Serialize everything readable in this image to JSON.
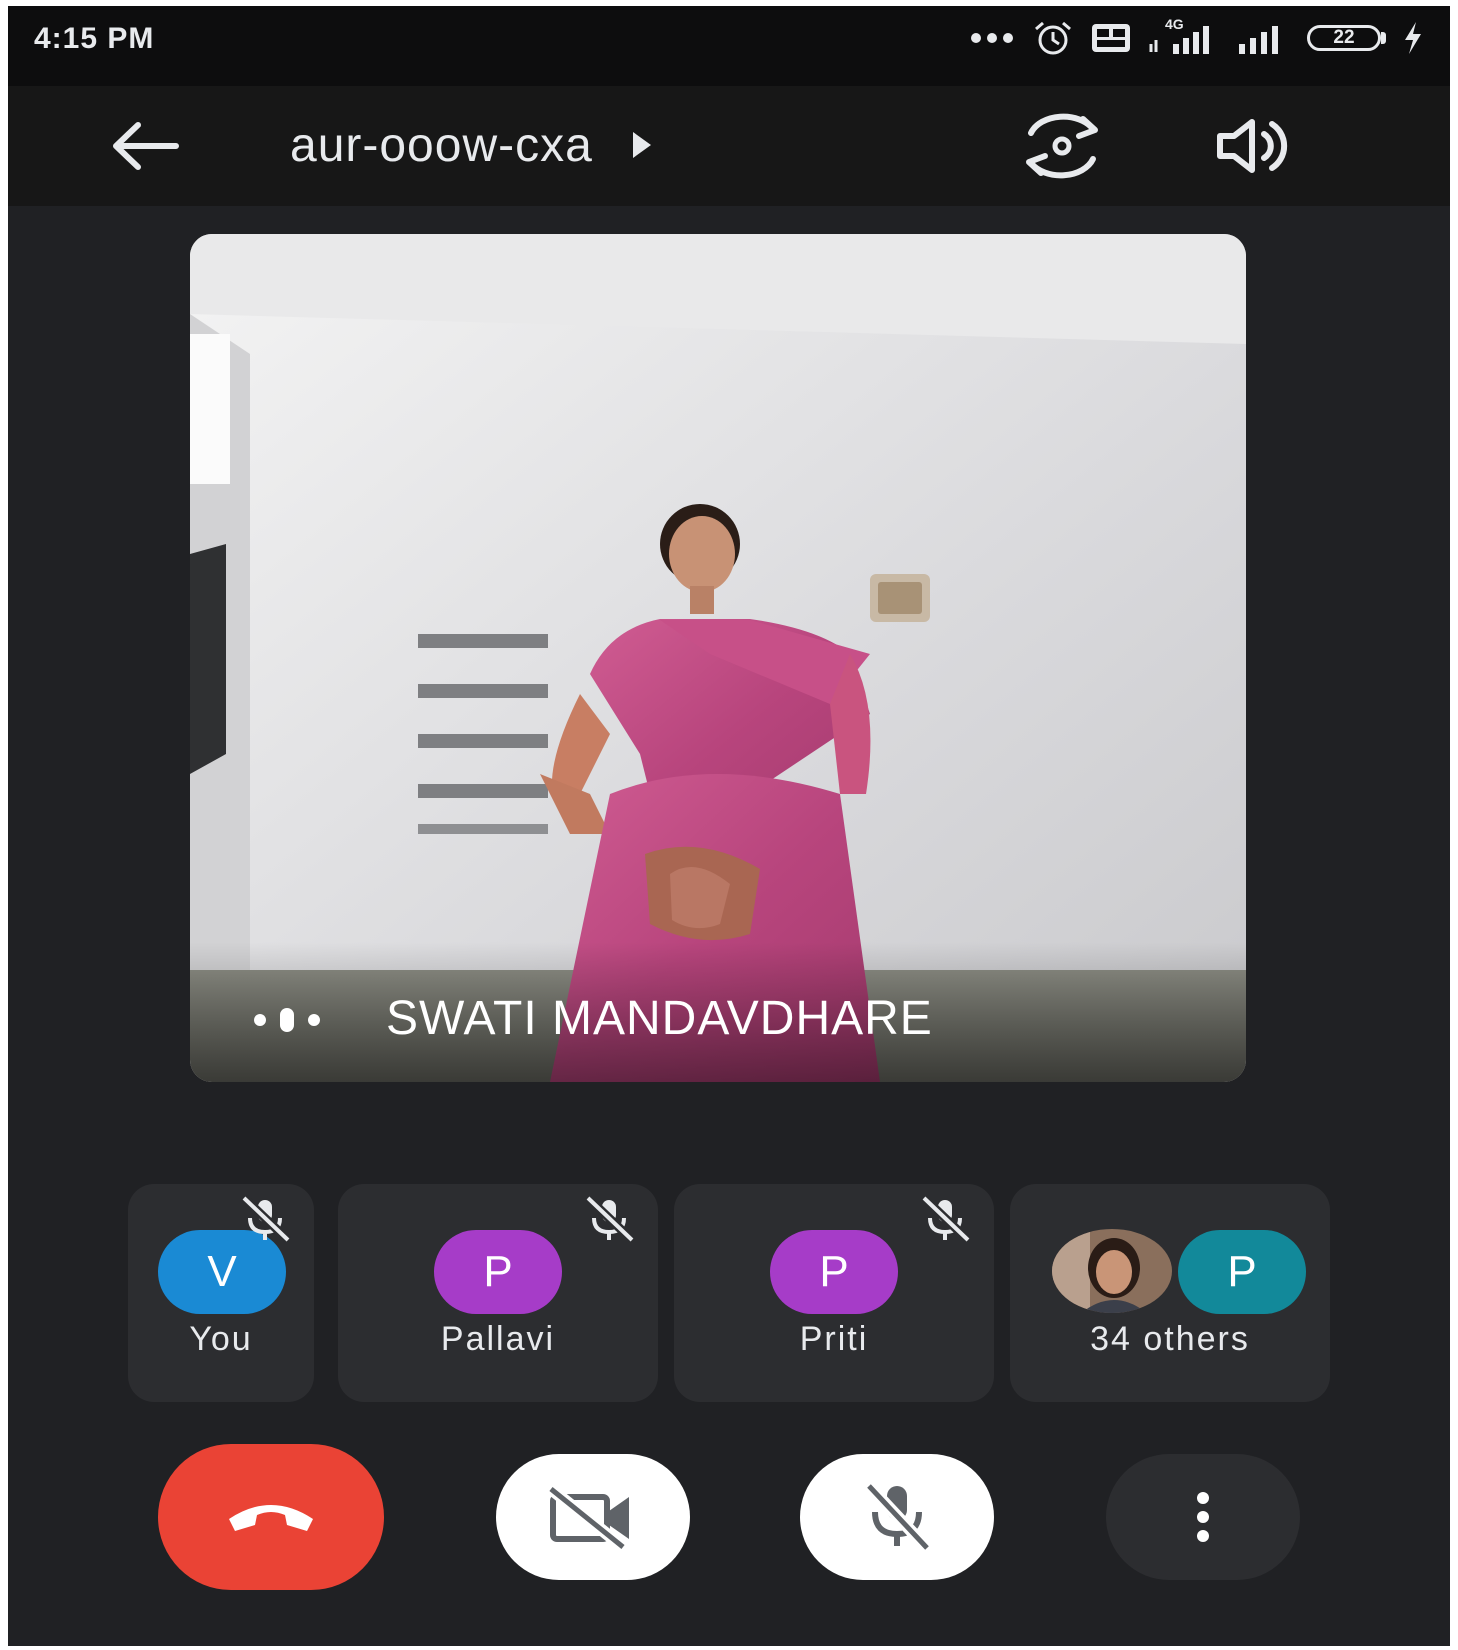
{
  "status_bar": {
    "time": "4:15 PM",
    "network_label": "4G",
    "battery_level": "22",
    "icons": [
      "more-dots-icon",
      "alarm-icon",
      "volte-icon",
      "signal-icon",
      "signal-icon",
      "battery-icon",
      "charging-icon"
    ]
  },
  "header": {
    "meeting_code": "aur-ooow-cxa",
    "icons": [
      "back-arrow-icon",
      "play-arrow-icon",
      "switch-camera-icon",
      "speaker-icon"
    ]
  },
  "main_video": {
    "speaker_name": "SWATI MANDAVDHARE"
  },
  "participants": [
    {
      "initial": "V",
      "name": "You",
      "avatar_color": "#1a8ad4",
      "muted": true
    },
    {
      "initial": "P",
      "name": "Pallavi",
      "avatar_color": "#a63cc8",
      "muted": true
    },
    {
      "initial": "P",
      "name": "Priti",
      "avatar_color": "#a63cc8",
      "muted": true
    },
    {
      "initial": "P",
      "name": "34 others",
      "avatar_color": "#12899a",
      "muted": false
    }
  ],
  "controls": {
    "icons": [
      "end-call-icon",
      "camera-off-icon",
      "mic-off-icon",
      "more-vert-icon"
    ],
    "end_call_color": "#ea4335"
  }
}
